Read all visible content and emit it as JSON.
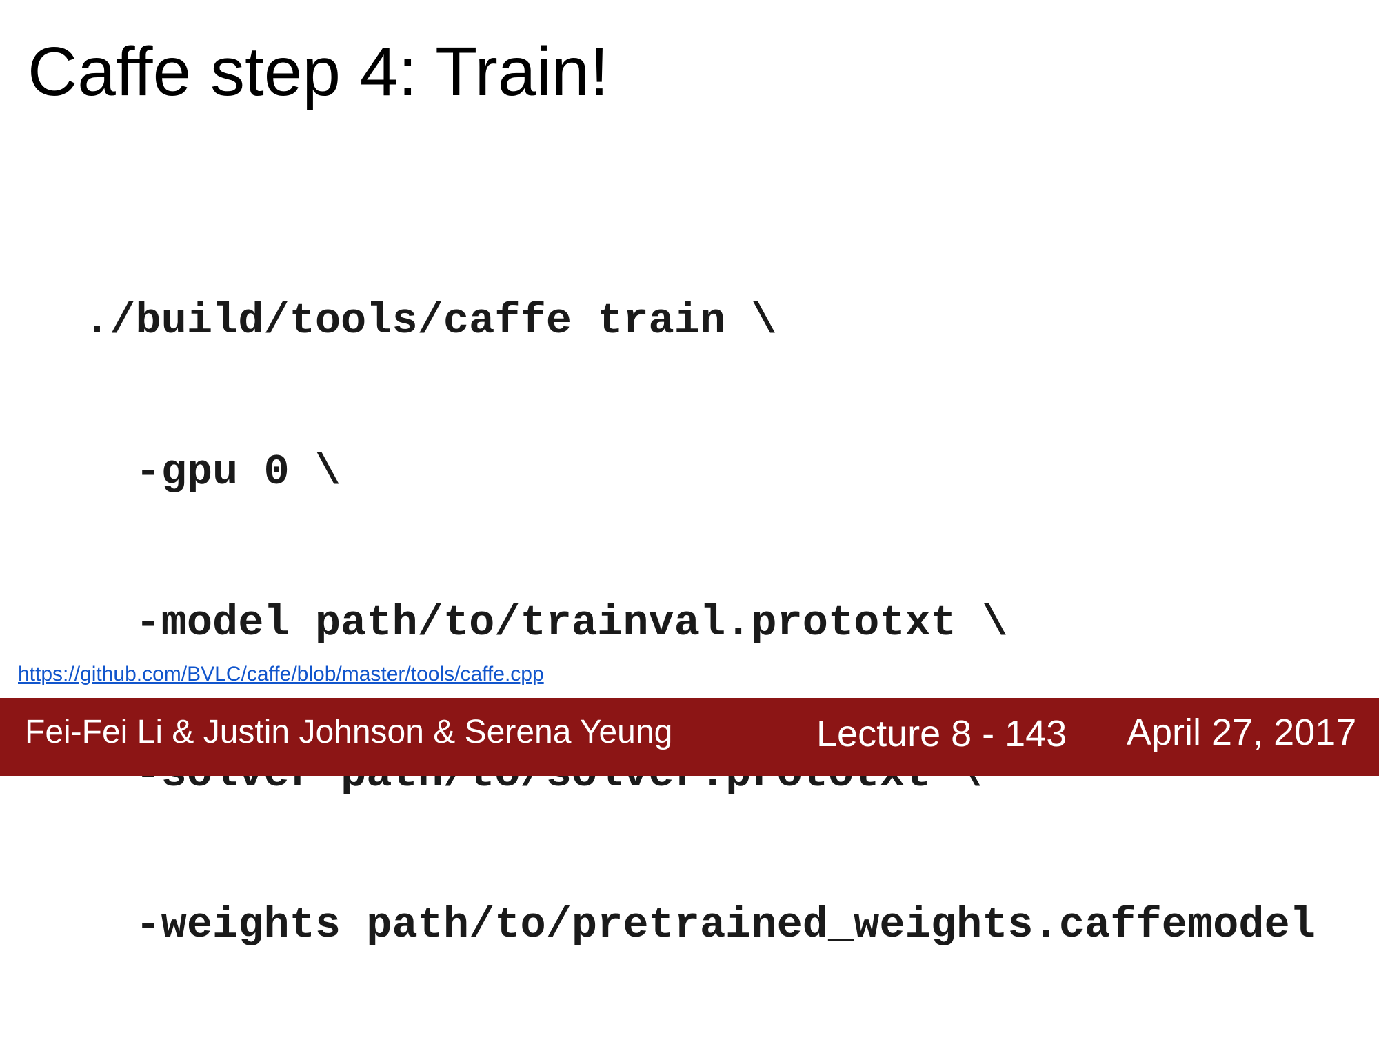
{
  "slide": {
    "title": "Caffe step 4: Train!",
    "code_lines": [
      "./build/tools/caffe train \\",
      "  -gpu 0 \\",
      "  -model path/to/trainval.prototxt \\",
      "  -solver path/to/solver.prototxt \\",
      "  -weights path/to/pretrained_weights.caffemodel"
    ],
    "source_link": "https://github.com/BVLC/caffe/blob/master/tools/caffe.cpp"
  },
  "footer": {
    "authors": "Fei-Fei Li & Justin Johnson & Serena Yeung",
    "lecture": "Lecture 8 - 143",
    "date": "April 27, 2017"
  },
  "colors": {
    "footer_background": "#8c1515",
    "link": "#1155cc"
  }
}
